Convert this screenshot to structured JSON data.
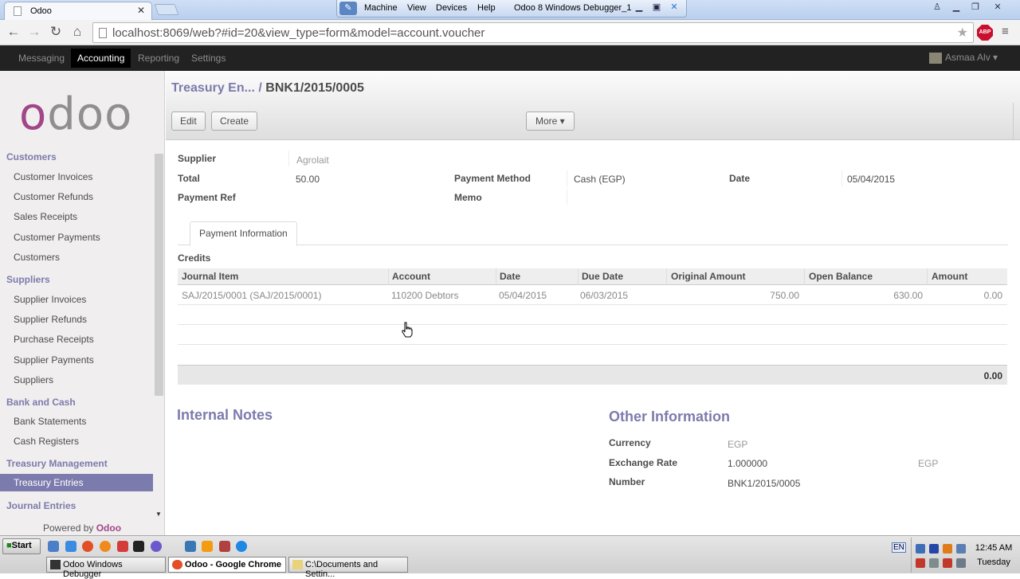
{
  "browser": {
    "tab_title": "Odoo",
    "url": "localhost:8069/web?#id=20&view_type=form&model=account.voucher",
    "vm_menu": [
      "Machine",
      "View",
      "Devices",
      "Help"
    ],
    "vm_title": "Odoo 8 Windows Debugger_1"
  },
  "topbar": {
    "menus": [
      "Messaging",
      "Accounting",
      "Reporting",
      "Settings"
    ],
    "active_menu": "Accounting",
    "user": "Asmaa Alv"
  },
  "sidebar": {
    "logo": "odoo",
    "sections": [
      {
        "title": "Customers",
        "items": [
          "Customer Invoices",
          "Customer Refunds",
          "Sales Receipts",
          "Customer Payments",
          "Customers"
        ]
      },
      {
        "title": "Suppliers",
        "items": [
          "Supplier Invoices",
          "Supplier Refunds",
          "Purchase Receipts",
          "Supplier Payments",
          "Suppliers"
        ]
      },
      {
        "title": "Bank and Cash",
        "items": [
          "Bank Statements",
          "Cash Registers"
        ]
      },
      {
        "title": "Treasury Management",
        "items": [
          "Treasury Entries"
        ]
      },
      {
        "title": "Journal Entries",
        "items": []
      }
    ],
    "active_item": "Treasury Entries",
    "powered_by": "Powered by",
    "powered_brand": "Odoo"
  },
  "control_panel": {
    "breadcrumb_parent": "Treasury En...",
    "breadcrumb_sep": "/",
    "breadcrumb_current": "BNK1/2015/0005",
    "edit_label": "Edit",
    "create_label": "Create",
    "more_label": "More ▾"
  },
  "form": {
    "supplier_label": "Supplier",
    "supplier_value": "Agrolait",
    "total_label": "Total",
    "total_value": "50.00",
    "payment_ref_label": "Payment Ref",
    "payment_method_label": "Payment Method",
    "payment_method_value": "Cash (EGP)",
    "memo_label": "Memo",
    "date_label": "Date",
    "date_value": "05/04/2015",
    "tab_label": "Payment Information",
    "credits_title": "Credits",
    "columns": [
      "Journal Item",
      "Account",
      "Date",
      "Due Date",
      "Original Amount",
      "Open Balance",
      "Amount"
    ],
    "rows": [
      {
        "journal_item": "SAJ/2015/0001 (SAJ/2015/0001)",
        "account": "110200 Debtors",
        "date": "05/04/2015",
        "due_date": "06/03/2015",
        "original_amount": "750.00",
        "open_balance": "630.00",
        "amount": "0.00"
      }
    ],
    "total_footer": "0.00",
    "internal_notes_title": "Internal Notes",
    "other_info_title": "Other Information",
    "currency_label": "Currency",
    "currency_value": "EGP",
    "exchange_rate_label": "Exchange Rate",
    "exchange_rate_value": "1.000000",
    "exchange_rate_currency": "EGP",
    "number_label": "Number",
    "number_value": "BNK1/2015/0005"
  },
  "taskbar": {
    "start_label": "Start",
    "tasks": [
      "Odoo Windows Debugger",
      "Odoo - Google Chrome",
      "C:\\Documents and Settin..."
    ],
    "active_task": "Odoo - Google Chrome",
    "lang": "EN",
    "time": "12:45 AM",
    "day": "Tuesday"
  },
  "colors": {
    "brand": "#7c7bad",
    "logo_o": "#a24689",
    "topbar": "#222222"
  }
}
